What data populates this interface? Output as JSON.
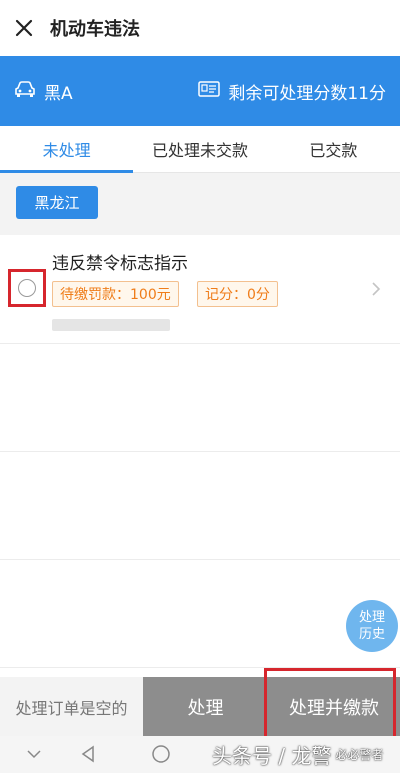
{
  "header": {
    "title": "机动车违法"
  },
  "vehicle": {
    "plate": "黑A",
    "remaining_points": "剩余可处理分数11分"
  },
  "tabs": [
    {
      "label": "未处理",
      "active": true
    },
    {
      "label": "已处理未交款",
      "active": false
    },
    {
      "label": "已交款",
      "active": false
    }
  ],
  "filter": {
    "region": "黑龙江"
  },
  "violations": [
    {
      "title": "违反禁令标志指示",
      "fine": "待缴罚款：100元",
      "points": "记分：0分"
    }
  ],
  "fab": {
    "line1": "处理",
    "line2": "历史"
  },
  "bottom": {
    "empty_note": "处理订单是空的",
    "process_label": "处理",
    "process_pay_label": "处理并缴款"
  },
  "watermark": {
    "text": "头条号 / 龙警",
    "small": "必必警者"
  },
  "colors": {
    "primary": "#2f8be6",
    "highlight": "#d6262d",
    "tag_text": "#ef7d1a"
  }
}
